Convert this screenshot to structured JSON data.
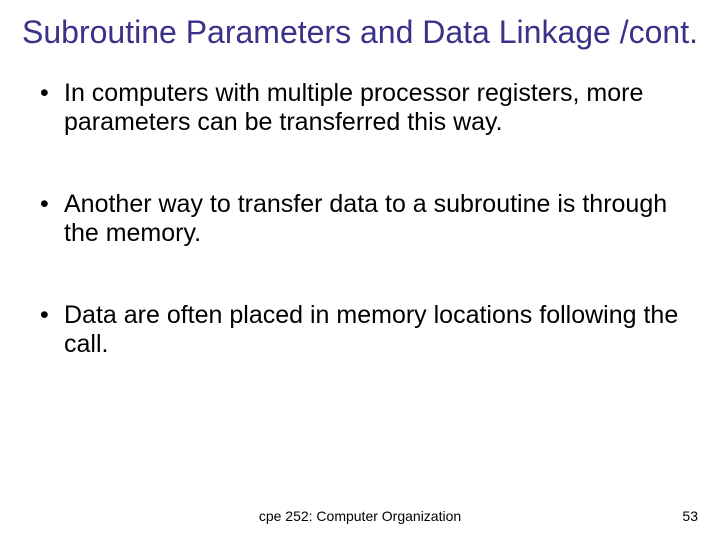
{
  "title": "Subroutine Parameters and Data Linkage /cont.",
  "bullets": [
    "In computers with multiple processor registers, more parameters can be transferred this way.",
    "Another way to transfer data to a subroutine is through the memory.",
    "Data are often placed in memory locations following the call."
  ],
  "footer": {
    "course": "cpe 252: Computer Organization",
    "page": "53"
  }
}
